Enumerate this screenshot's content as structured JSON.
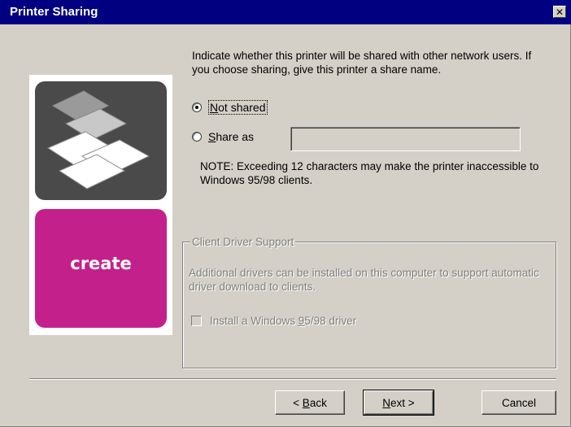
{
  "window": {
    "title": "Printer Sharing",
    "close_icon": "close-icon"
  },
  "graphic": {
    "brand_label": "create",
    "colors": {
      "top": "#4a4a4a",
      "bottom": "#c4208c"
    }
  },
  "intro_text": "Indicate whether this printer will be shared with other network users.  If you choose sharing, give this printer a share name.",
  "options": {
    "not_shared": {
      "label_prefix": "",
      "underline": "N",
      "label_rest": "ot shared",
      "selected": true
    },
    "share_as": {
      "underline": "S",
      "label_rest": "hare as",
      "selected": false,
      "value": ""
    }
  },
  "note": "NOTE:  Exceeding 12 characters may make the printer inaccessible to Windows 95/98 clients.",
  "client_driver_support": {
    "legend": "Client Driver Support",
    "description": "Additional drivers can be installed on this computer to support automatic driver download to clients.",
    "checkbox": {
      "label_prefix": "Install a Windows ",
      "underline": "9",
      "label_rest": "5/98 driver",
      "checked": false,
      "enabled": false
    }
  },
  "buttons": {
    "back": {
      "prefix": "< ",
      "underline": "B",
      "rest": "ack"
    },
    "next": {
      "underline": "N",
      "rest": "ext >"
    },
    "cancel": {
      "label": "Cancel"
    }
  }
}
